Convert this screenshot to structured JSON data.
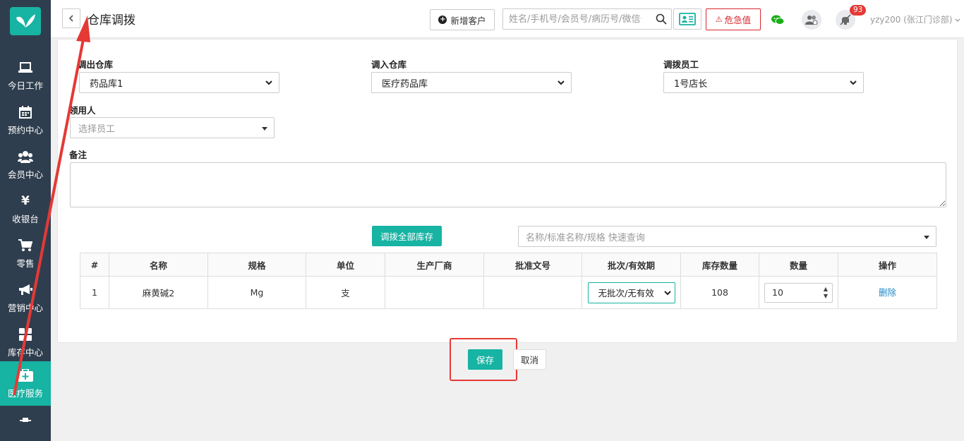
{
  "sidebar": {
    "items": [
      {
        "label": "今日工作",
        "icon": "laptop-icon"
      },
      {
        "label": "预约中心",
        "icon": "calendar-icon"
      },
      {
        "label": "会员中心",
        "icon": "users-icon"
      },
      {
        "label": "收银台",
        "icon": "yen-icon"
      },
      {
        "label": "零售",
        "icon": "cart-icon"
      },
      {
        "label": "营销中心",
        "icon": "megaphone-icon"
      },
      {
        "label": "库存中心",
        "icon": "grid-icon"
      },
      {
        "label": "医疗服务",
        "icon": "medical-kit-icon"
      }
    ],
    "active_index": 7,
    "active_color": "#17b3a3",
    "bg_color": "#2f3e4e"
  },
  "header": {
    "title": "仓库调拨",
    "add_customer_label": "新增客户",
    "search_placeholder": "姓名/手机号/会员号/病历号/微信号",
    "critical_label": "危急值",
    "notification_count": "93",
    "user": "yzy200 (张江门诊部)"
  },
  "form": {
    "out_warehouse_label": "调出仓库",
    "out_warehouse_value": "药品库1",
    "in_warehouse_label": "调入仓库",
    "in_warehouse_value": "医疗药品库",
    "staff_label": "调拨员工",
    "staff_value": "1号店长",
    "recipient_label": "领用人",
    "recipient_placeholder": "选择员工",
    "remark_label": "备注"
  },
  "items_section": {
    "transfer_all_label": "调拨全部库存",
    "quick_query_placeholder": "名称/标准名称/规格 快速查询",
    "columns": [
      "#",
      "名称",
      "规格",
      "单位",
      "生产厂商",
      "批准文号",
      "批次/有效期",
      "库存数量",
      "数量",
      "操作"
    ],
    "rows": [
      {
        "index": "1",
        "name": "麻黄碱2",
        "spec": "Mg",
        "unit": "支",
        "manufacturer": "",
        "approval_no": "",
        "batch": "无批次/无有效",
        "stock": "108",
        "quantity": "10",
        "action": "删除"
      }
    ]
  },
  "actions": {
    "save_label": "保存",
    "cancel_label": "取消"
  },
  "colors": {
    "accent": "#17b3a3",
    "danger": "#d9262c",
    "link": "#1e88c8",
    "annotation": "#e53935"
  }
}
